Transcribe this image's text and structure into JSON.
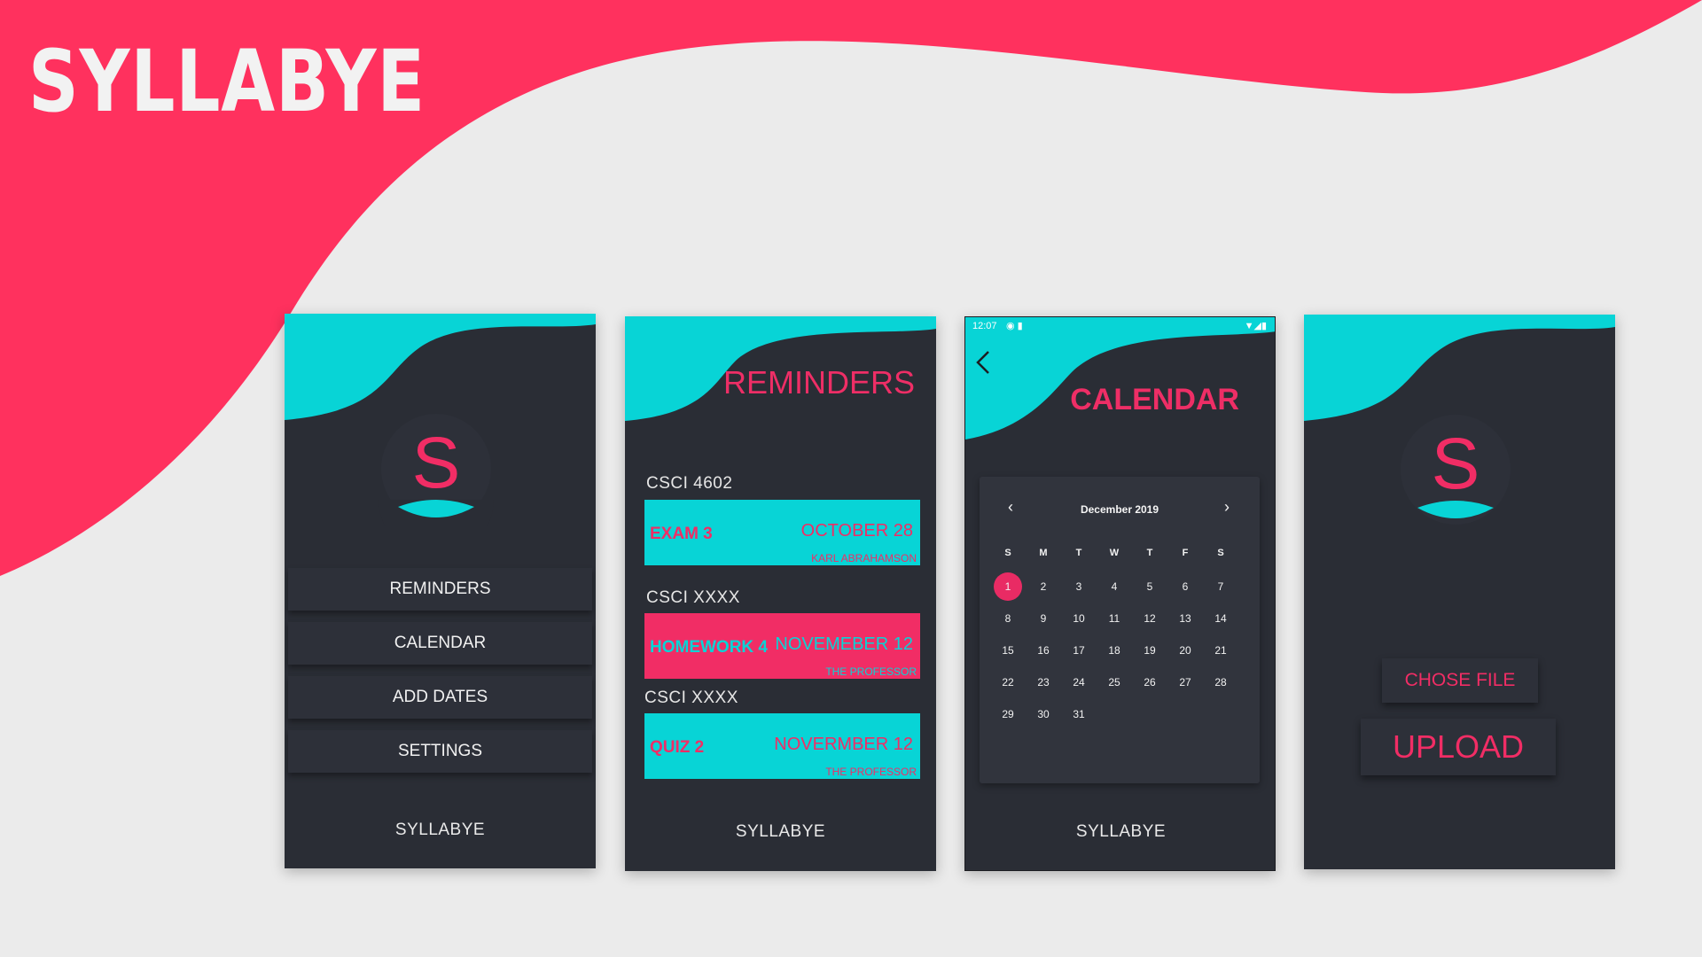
{
  "brand": {
    "title": "SYLLABYE"
  },
  "colors": {
    "pink": "#f12d65",
    "cyan": "#08d4d6",
    "dark": "#2a2d35",
    "background": "#ebebeb"
  },
  "menu_screen": {
    "logo_letter": "S",
    "items": [
      "REMINDERS",
      "CALENDAR",
      "ADD DATES",
      "SETTINGS"
    ],
    "footer": "SYLLABYE"
  },
  "reminders_screen": {
    "title": "REMINDERS",
    "groups": [
      {
        "course": "CSCI 4602",
        "title": "EXAM 3",
        "date": "OCTOBER 28",
        "professor": "KARL ABRAHAMSON",
        "color": "cyan"
      },
      {
        "course": "CSCI  XXXX",
        "title": "HOMEWORK 4",
        "date": "NOVEMEBER 12",
        "professor": "THE PROFESSOR",
        "color": "pink"
      },
      {
        "course": "CSCI  XXXX",
        "title": "QUIZ 2",
        "date": "NOVERMBER 12",
        "professor": "THE PROFESSOR",
        "color": "cyan"
      }
    ],
    "footer": "SYLLABYE"
  },
  "calendar_screen": {
    "status_time": "12:07",
    "back_icon": "back-arrow-icon",
    "title": "CALENDAR",
    "month": "December 2019",
    "weekdays": [
      "S",
      "M",
      "T",
      "W",
      "T",
      "F",
      "S"
    ],
    "weeks": [
      [
        "1",
        "2",
        "3",
        "4",
        "5",
        "6",
        "7"
      ],
      [
        "8",
        "9",
        "10",
        "11",
        "12",
        "13",
        "14"
      ],
      [
        "15",
        "16",
        "17",
        "18",
        "19",
        "20",
        "21"
      ],
      [
        "22",
        "23",
        "24",
        "25",
        "26",
        "27",
        "28"
      ],
      [
        "29",
        "30",
        "31",
        "",
        "",
        "",
        ""
      ]
    ],
    "selected_day": "1",
    "footer": "SYLLABYE"
  },
  "upload_screen": {
    "logo_letter": "S",
    "choose_label": "CHOSE FILE",
    "upload_label": "UPLOAD"
  }
}
